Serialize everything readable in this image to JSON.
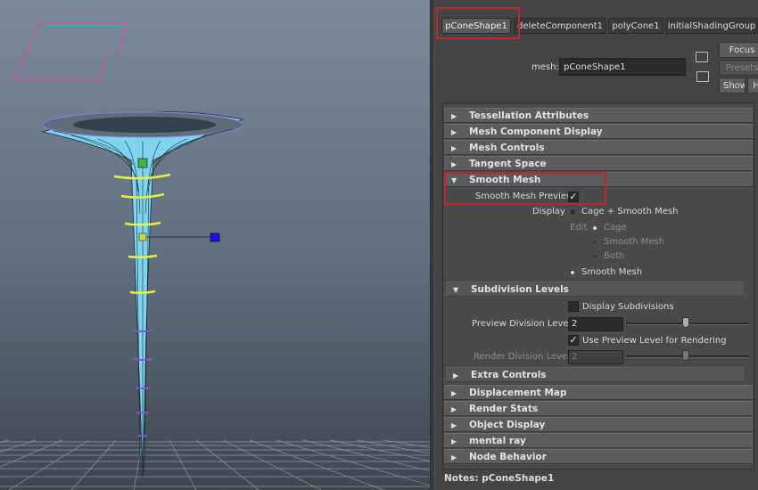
{
  "viewport": {
    "grid_color": "#9aa3ad",
    "mesh_color": "#7fd3ee",
    "wire_color": "#1a2a33",
    "selected_edge_color": "#e7f33a",
    "purple_edge_color": "#7f5bd1"
  },
  "tabs": [
    "pConeShape1",
    "deleteComponent1",
    "polyCone1",
    "initialShadingGroup"
  ],
  "mesh": {
    "label": "mesh:",
    "value": "pConeShape1"
  },
  "buttons": {
    "focus": "Focus",
    "presets": "Presets",
    "show": "Show",
    "hide": "H"
  },
  "sections_top": [
    "Tessellation Attributes",
    "Mesh Component Display",
    "Mesh Controls",
    "Tangent Space"
  ],
  "smooth_mesh": {
    "title": "Smooth Mesh",
    "preview_label": "Smooth Mesh Preview",
    "preview_checked": "✓",
    "display_label": "Display",
    "display_option_1": "Cage + Smooth Mesh",
    "edit_label": "Edit",
    "edit_option_1": "Cage",
    "edit_option_2": "Smooth Mesh",
    "edit_option_3": "Both",
    "display_option_2": "Smooth Mesh"
  },
  "subdivision": {
    "title": "Subdivision Levels",
    "display_subdivisions": "Display Subdivisions",
    "preview_levels_label": "Preview Division Levels",
    "preview_levels_value": "2",
    "use_preview_label": "Use Preview Level for Rendering",
    "use_preview_checked": "✓",
    "render_levels_label": "Render Division Levels",
    "render_levels_value": "2"
  },
  "extra_controls": "Extra Controls",
  "sections_bottom": [
    "Displacement Map",
    "Render Stats",
    "Object Display",
    "mental ray",
    "Node Behavior"
  ],
  "notes": {
    "label": "Notes:",
    "value": "pConeShape1"
  }
}
